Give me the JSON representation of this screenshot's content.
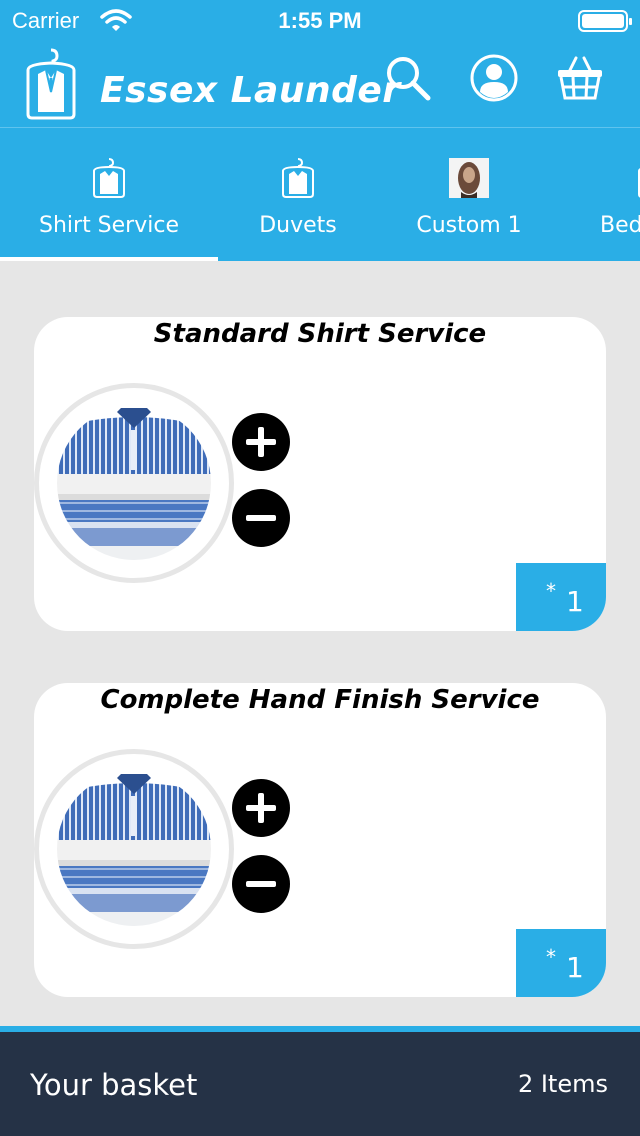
{
  "status_bar": {
    "carrier": "Carrier",
    "time": "1:55 PM"
  },
  "header": {
    "app_title": "Essex Launder",
    "icons": [
      "shirt-logo-icon",
      "search-icon",
      "profile-icon",
      "basket-icon"
    ]
  },
  "tabs": [
    {
      "label": "Shirt Service",
      "icon": "shirt-hanger-icon",
      "selected": true
    },
    {
      "label": "Duvets",
      "icon": "shirt-hanger-icon",
      "selected": false
    },
    {
      "label": "Custom 1",
      "icon": "custom-photo",
      "selected": false
    },
    {
      "label": "Bed",
      "icon": "shirt-hanger-icon",
      "selected": false
    }
  ],
  "services": [
    {
      "title": "Standard Shirt Service",
      "image": "folded-shirts-photo",
      "qty_prefix": "*",
      "quantity": "1",
      "actions": [
        "plus-icon",
        "minus-icon"
      ]
    },
    {
      "title": "Complete Hand Finish Service",
      "image": "folded-shirts-photo",
      "qty_prefix": "*",
      "quantity": "1",
      "actions": [
        "plus-icon",
        "minus-icon"
      ]
    }
  ],
  "basket": {
    "label": "Your basket",
    "count": "2 Items"
  },
  "colors": {
    "primary": "#2aaee6",
    "footer": "#253246",
    "background": "#e6e6e6"
  }
}
